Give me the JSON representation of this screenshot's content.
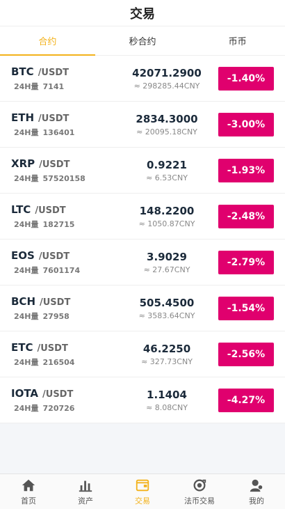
{
  "header": {
    "title": "交易"
  },
  "tabs": [
    {
      "label": "合约",
      "active": true
    },
    {
      "label": "秒合约",
      "active": false
    },
    {
      "label": "币币",
      "active": false
    }
  ],
  "markets": [
    {
      "symbol": "BTC",
      "quote": "/USDT",
      "vol_label": "24H量",
      "volume": "7141",
      "price": "42071.2900",
      "cny": "≈ 298285.44CNY",
      "change": "-1.40%"
    },
    {
      "symbol": "ETH",
      "quote": "/USDT",
      "vol_label": "24H量",
      "volume": "136401",
      "price": "2834.3000",
      "cny": "≈ 20095.18CNY",
      "change": "-3.00%"
    },
    {
      "symbol": "XRP",
      "quote": "/USDT",
      "vol_label": "24H量",
      "volume": "57520158",
      "price": "0.9221",
      "cny": "≈ 6.53CNY",
      "change": "-1.93%"
    },
    {
      "symbol": "LTC",
      "quote": "/USDT",
      "vol_label": "24H量",
      "volume": "182715",
      "price": "148.2200",
      "cny": "≈ 1050.87CNY",
      "change": "-2.48%"
    },
    {
      "symbol": "EOS",
      "quote": "/USDT",
      "vol_label": "24H量",
      "volume": "7601174",
      "price": "3.9029",
      "cny": "≈ 27.67CNY",
      "change": "-2.79%"
    },
    {
      "symbol": "BCH",
      "quote": "/USDT",
      "vol_label": "24H量",
      "volume": "27958",
      "price": "505.4500",
      "cny": "≈ 3583.64CNY",
      "change": "-1.54%"
    },
    {
      "symbol": "ETC",
      "quote": "/USDT",
      "vol_label": "24H量",
      "volume": "216504",
      "price": "46.2250",
      "cny": "≈ 327.73CNY",
      "change": "-2.56%"
    },
    {
      "symbol": "IOTA",
      "quote": "/USDT",
      "vol_label": "24H量",
      "volume": "720726",
      "price": "1.1404",
      "cny": "≈ 8.08CNY",
      "change": "-4.27%"
    }
  ],
  "nav": [
    {
      "label": "首页",
      "icon": "home-icon",
      "active": false
    },
    {
      "label": "资产",
      "icon": "assets-icon",
      "active": false
    },
    {
      "label": "交易",
      "icon": "trade-icon",
      "active": true
    },
    {
      "label": "法币交易",
      "icon": "fiat-icon",
      "active": false
    },
    {
      "label": "我的",
      "icon": "user-icon",
      "active": false
    }
  ],
  "colors": {
    "accent": "#f3b21b",
    "down": "#e0006e",
    "text": "#1b2a3a"
  }
}
